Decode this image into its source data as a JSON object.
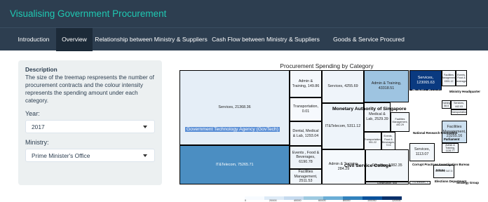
{
  "app": {
    "title": "Visualising Government Procurement"
  },
  "nav": {
    "tabs": [
      {
        "label": "Introduction"
      },
      {
        "label": "Overview"
      },
      {
        "label": "Relationship between Ministry & Suppliers"
      },
      {
        "label": "Cash Flow between Ministry & Suppliers"
      },
      {
        "label": "Goods & Service Procured"
      }
    ],
    "active": "Overview"
  },
  "sidebar": {
    "description_title": "Description",
    "description_text": "The size of the treemap respresents the number of procurement contracts and the colour intensity represents the spending amount under each category.",
    "year_label": "Year:",
    "year_value": "2017",
    "ministry_label": "Ministry:",
    "ministry_value": "Prime Minister's Office"
  },
  "treemap": {
    "title": "Procurement Spending by Category",
    "groups": [
      {
        "name": "Government Technology Agency (GovTech)"
      },
      {
        "name": "Monetary Authority of Singapore"
      },
      {
        "name": "Public Service Division"
      },
      {
        "name": "Ministry Headquarter"
      },
      {
        "name": "National Research Foundation"
      },
      {
        "name": "Parliament"
      },
      {
        "name": "Civil Service College"
      },
      {
        "name": "Istana"
      },
      {
        "name": "Corrupt Practices Investigation Bureau"
      },
      {
        "name": "Elections Department"
      },
      {
        "name": "Strategy Group"
      }
    ],
    "tiles": [
      {
        "label": "Services, 21368.36",
        "value": 21368.36,
        "color": "#e5eef7"
      },
      {
        "label": "IT&Telecom, 75265.71",
        "value": 75265.71,
        "color": "#4b8ec2"
      },
      {
        "label": "Admin & Training, 149.86",
        "value": 149.86,
        "color": "#f4f8fc"
      },
      {
        "label": "Transportation, 0.01",
        "value": 0.01,
        "color": "#f6f9fd"
      },
      {
        "label": "Dental, Medical & Lab, 1293.04",
        "value": 1293.04,
        "color": "#f2f6fb"
      },
      {
        "label": "Events , Food & Beverages, 6190.78",
        "value": 6190.78,
        "color": "#eef3f9"
      },
      {
        "label": "Facilities Management, 2511.53",
        "value": 2511.53,
        "color": "#f0f5fa"
      },
      {
        "label": "Services, 4255.69",
        "value": 4255.69,
        "color": "#eff4fa"
      },
      {
        "label": "Admin & Training, 43318.51",
        "value": 43318.51,
        "color": "#9ec4e1"
      },
      {
        "label": "IT&Telecom, 5311.12",
        "value": 5311.12,
        "color": "#eef4fa"
      },
      {
        "label": "Medical & Lab, 2529.39",
        "value": 2529.39,
        "color": "#f0f5fa"
      },
      {
        "label": "Facilities Management, 492.29",
        "value": 492.29,
        "color": "#f4f8fc"
      },
      {
        "label": "Transportation, 551.22",
        "value": 551.22,
        "color": "#f4f8fc"
      },
      {
        "label": "Events , Food & Beverages, 72.6",
        "value": 72.6,
        "color": "#f5f9fd"
      },
      {
        "label": "Admin & Training, 284.29",
        "value": 284.29,
        "color": "#f5f9fd"
      },
      {
        "label": "Services, 1382.35",
        "value": 1382.35,
        "color": "#f3f7fb"
      },
      {
        "label": "Construction, 608",
        "value": 608,
        "color": "#f4f8fc"
      },
      {
        "label": "Services, 123065.63",
        "value": 123065.63,
        "color": "#0a3a80"
      },
      {
        "label": "Facilities Management, 1591.12",
        "value": 1591.12,
        "color": "#f2f6fb"
      },
      {
        "label": "Events, Food & Beverages",
        "value": null,
        "color": "#f6f9fd"
      },
      {
        "label": "Training, 58.5",
        "value": 58.5,
        "color": "#f5f9fd"
      },
      {
        "label": "Services, 442.03",
        "value": 442.03,
        "color": "#f4f8fc"
      },
      {
        "label": "Transportation",
        "value": null,
        "color": "#f6f9fd"
      },
      {
        "label": "Facilities Management, 23255.16",
        "value": 23255.16,
        "color": "#cde0f0"
      },
      {
        "label": "Admin & Training, 1126.77",
        "value": 1126.77,
        "color": "#f3f7fb"
      },
      {
        "label": "Services, 1113.07",
        "value": 1113.07,
        "color": "#f3f7fb"
      },
      {
        "label": "Services, 547.5",
        "value": 547.5,
        "color": "#f4f8fc"
      },
      {
        "label": "IT&Telecom, 3",
        "value": 3,
        "color": "#f6f9fd"
      }
    ],
    "legend_ticks": [
      "0",
      "20000",
      "40000",
      "60000",
      "80000",
      "100000",
      "120000"
    ],
    "legend_colors": [
      "#f7fbff",
      "#deebf7",
      "#c6dbef",
      "#9ecae1",
      "#6baed6",
      "#3182bd",
      "#08519c",
      "#08306b"
    ]
  }
}
